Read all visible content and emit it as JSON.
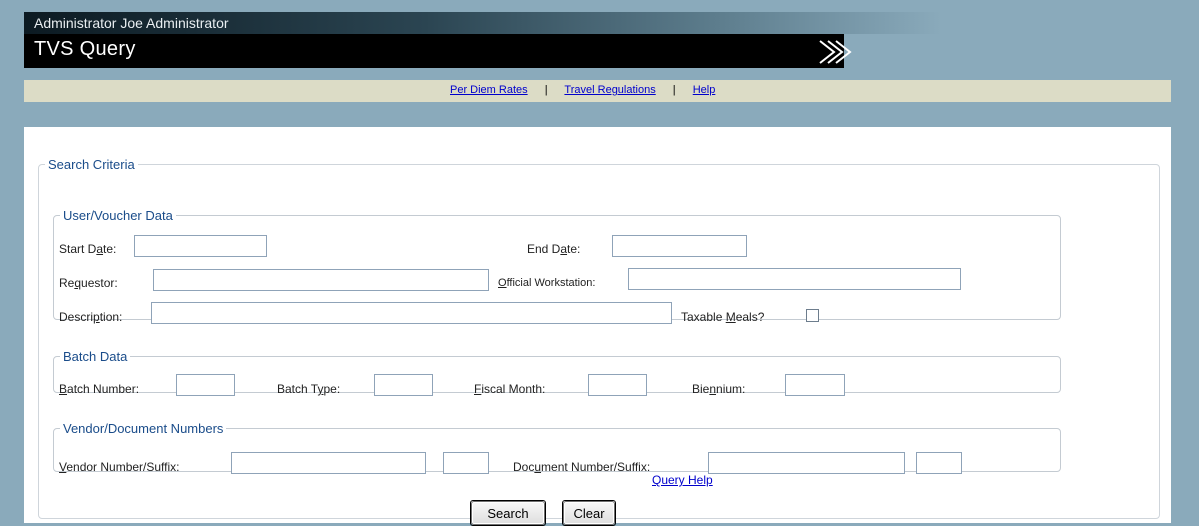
{
  "header": {
    "user_line": "Administrator Joe Administrator",
    "app_title": "TVS Query",
    "chevron_icon": "double-chevron-right-icon"
  },
  "nav": {
    "links": [
      "Per Diem Rates",
      "Travel Regulations",
      "Help"
    ],
    "separator": "|"
  },
  "search_criteria": {
    "legend": "Search Criteria",
    "user_voucher": {
      "legend": "User/Voucher Data",
      "start_date": {
        "pre": "Start D",
        "ul": "a",
        "post": "te:",
        "value": ""
      },
      "end_date": {
        "pre": "End D",
        "ul": "a",
        "post": "te:",
        "value": ""
      },
      "requestor": {
        "pre": "Re",
        "ul": "q",
        "post": "uestor:",
        "value": ""
      },
      "official_workstation": {
        "pre": "",
        "ul": "O",
        "post": "fficial Workstation:",
        "value": ""
      },
      "description": {
        "pre": "Descri",
        "ul": "p",
        "post": "tion:",
        "value": ""
      },
      "taxable_meals": {
        "pre": "Taxable ",
        "ul": "M",
        "post": "eals?",
        "checked": false
      }
    },
    "batch_data": {
      "legend": "Batch Data",
      "batch_number": {
        "pre": "",
        "ul": "B",
        "post": "atch Number:",
        "value": ""
      },
      "batch_type": {
        "pre": "Batch T",
        "ul": "y",
        "post": "pe:",
        "value": ""
      },
      "fiscal_month": {
        "pre": "",
        "ul": "F",
        "post": "iscal Month:",
        "value": ""
      },
      "biennium": {
        "pre": "Bie",
        "ul": "n",
        "post": "nium:",
        "value": ""
      }
    },
    "vendor_document": {
      "legend": "Vendor/Document Numbers",
      "vendor_number": {
        "pre": "",
        "ul": "V",
        "post": "endor Number/Suffix:",
        "value": "",
        "suffix": ""
      },
      "document_number": {
        "pre": "Doc",
        "ul": "u",
        "post": "ment Number/Suffix:",
        "value": "",
        "suffix": ""
      }
    }
  },
  "actions": {
    "search_label": "Search",
    "clear_label": "Clear",
    "query_help_label": "Query Help"
  },
  "colors": {
    "background": "#8aaabb",
    "nav_strip": "#dcdcc6",
    "link": "#0000cc",
    "legend": "#1a4c8a"
  }
}
